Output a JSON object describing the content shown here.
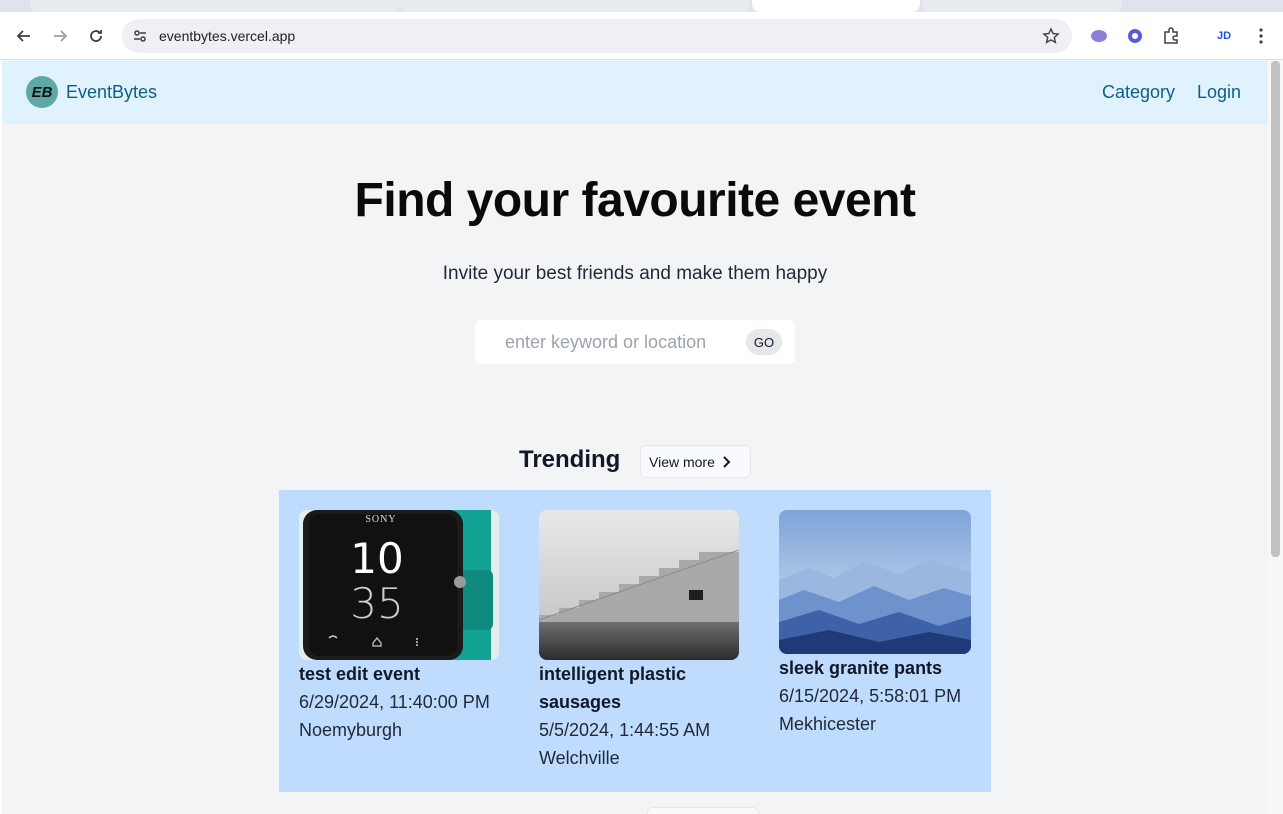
{
  "browser": {
    "url": "eventbytes.vercel.app"
  },
  "header": {
    "logo_text": "EB",
    "brand": "EventBytes",
    "nav": [
      "Category",
      "Login"
    ]
  },
  "hero": {
    "title": "Find your favourite event",
    "subtitle": "Invite your best friends and make them happy",
    "search_placeholder": "enter keyword or location",
    "search_button": "GO"
  },
  "trending": {
    "title": "Trending",
    "view_more": "View more",
    "events": [
      {
        "title": "test edit event",
        "date": "6/29/2024, 11:40:00 PM",
        "location": "Noemyburgh",
        "image": "smartwatch",
        "watch_brand": "SONY",
        "watch_hour": "10",
        "watch_minute": "35"
      },
      {
        "title": "intelligent plastic sausages",
        "date": "5/5/2024, 1:44:55 AM",
        "location": "Welchville",
        "image": "stone-stairs"
      },
      {
        "title": "sleek granite pants",
        "date": "6/15/2024, 5:58:01 PM",
        "location": "Mekhicester",
        "image": "blue-mountains"
      }
    ]
  },
  "colors": {
    "header_bg": "#e0f2fe",
    "brand_text": "#0c5f88",
    "cards_bg": "#bfdbfe",
    "page_bg": "#f3f4f6"
  }
}
